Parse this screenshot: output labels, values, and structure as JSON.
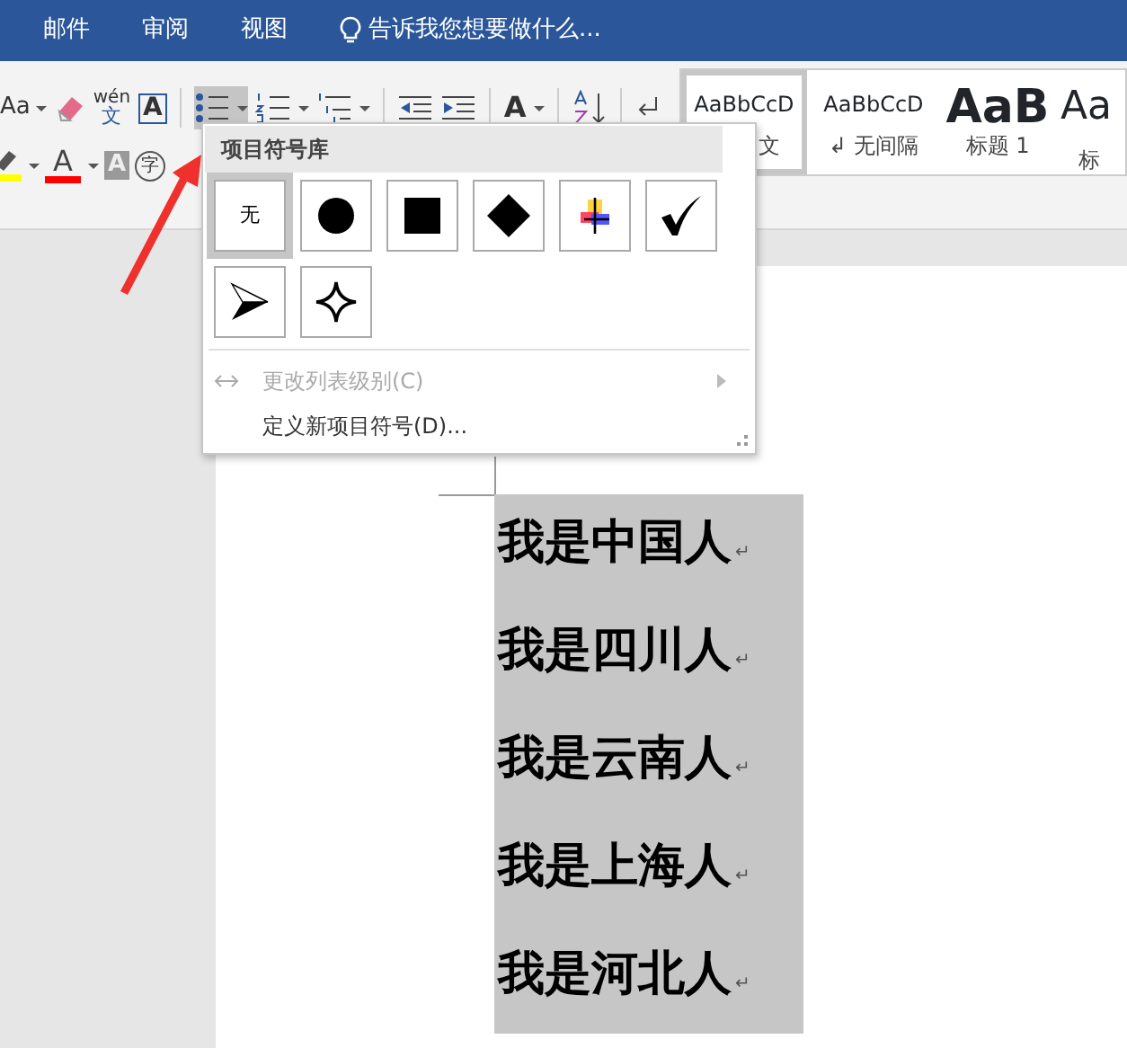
{
  "tabs": [
    {
      "label": "邮件"
    },
    {
      "label": "审阅"
    },
    {
      "label": "视图"
    }
  ],
  "tell_me": {
    "text": "告诉我您想要做什么..."
  },
  "ribbon": {
    "row1": [
      {
        "kind": "case",
        "glyph": "Aa"
      },
      {
        "kind": "eraser"
      },
      {
        "kind": "phonetic",
        "glyph": "wén",
        "sub": "文"
      },
      {
        "kind": "boxed",
        "glyph": "A"
      },
      {
        "kind": "sep"
      },
      {
        "kind": "bullets",
        "pressed": true
      },
      {
        "kind": "numbering",
        "pressed": false
      },
      {
        "kind": "multilevel",
        "pressed": false
      },
      {
        "kind": "sep"
      },
      {
        "kind": "outdent"
      },
      {
        "kind": "indent"
      },
      {
        "kind": "sep"
      },
      {
        "kind": "direction",
        "glyph": "A"
      },
      {
        "kind": "sep"
      },
      {
        "kind": "sort"
      },
      {
        "kind": "sep"
      },
      {
        "kind": "enter"
      }
    ],
    "row2": [
      {
        "kind": "highlight",
        "color": "#ffff00"
      },
      {
        "kind": "fontcolor",
        "glyph": "A",
        "color": "#ff0000"
      },
      {
        "kind": "shade",
        "glyph": "A"
      },
      {
        "kind": "enclose",
        "glyph": "字"
      }
    ]
  },
  "style_gallery": [
    {
      "preview": "AaBbCcD",
      "label": "文",
      "kind": "normal",
      "selected": true
    },
    {
      "preview": "AaBbCcD",
      "label": "无间隔",
      "mark": "↲",
      "kind": "normal",
      "selected": false
    },
    {
      "preview": "AaB",
      "label": "标题 1",
      "kind": "heading",
      "selected": false
    },
    {
      "preview": "Aa",
      "label": "标",
      "kind": "heading2",
      "selected": false
    }
  ],
  "bullet_menu": {
    "header": "项目符号库",
    "bullets": [
      {
        "kind": "none",
        "label": "无",
        "selected": true
      },
      {
        "kind": "dot",
        "selected": false
      },
      {
        "kind": "square",
        "selected": false
      },
      {
        "kind": "diamond",
        "selected": false
      },
      {
        "kind": "picture",
        "selected": false
      },
      {
        "kind": "check",
        "selected": false
      },
      {
        "kind": "arrowhead",
        "selected": false
      },
      {
        "kind": "star",
        "selected": false
      }
    ],
    "items": [
      {
        "label": "更改列表级别(C)",
        "disabled": true,
        "submenu": true
      },
      {
        "label": "定义新项目符号(D)...",
        "disabled": false,
        "submenu": false
      }
    ]
  },
  "document": {
    "lines": [
      {
        "text": "我是中国人",
        "mark": "↵"
      },
      {
        "text": "我是四川人",
        "mark": "↵"
      },
      {
        "text": "我是云南人",
        "mark": "↵"
      },
      {
        "text": "我是上海人",
        "mark": "↵"
      },
      {
        "text": "我是河北人",
        "mark": "↵"
      }
    ],
    "selected": true
  }
}
